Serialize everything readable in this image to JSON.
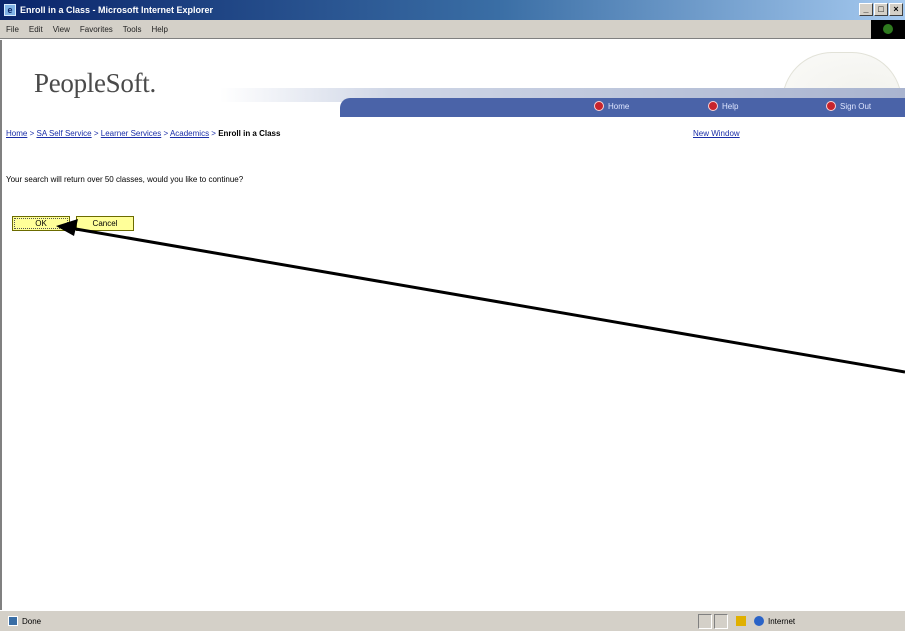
{
  "window": {
    "title": "Enroll in a Class - Microsoft Internet Explorer",
    "icon": "ie-page-icon",
    "buttons": [
      "_",
      "□",
      "×"
    ]
  },
  "menu": {
    "items": [
      "File",
      "Edit",
      "View",
      "Favorites",
      "Tools",
      "Help"
    ]
  },
  "header": {
    "logo": "PeopleSoft.",
    "nav": {
      "home": "Home",
      "help": "Help",
      "signout": "Sign Out"
    }
  },
  "breadcrumb": {
    "items": [
      "Home",
      "SA Self Service",
      "Learner Services",
      "Academics"
    ],
    "separator": ">",
    "current": "Enroll in a Class"
  },
  "new_window": "New Window",
  "message": "Your search will return over 50 classes, would you like to continue?",
  "buttons": {
    "ok": "OK",
    "cancel": "Cancel"
  },
  "status": {
    "text": "Done",
    "zone": "Internet"
  },
  "colors": {
    "button_bg": "#ffff99",
    "nav_bar": "#4a63a8",
    "link": "#1a2ea8"
  }
}
